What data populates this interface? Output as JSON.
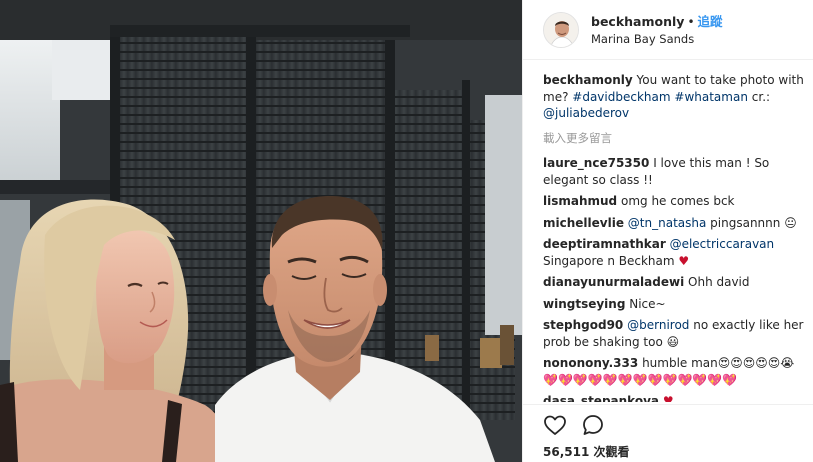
{
  "post": {
    "owner": "beckhamonly",
    "separator": "•",
    "follow_label": "追蹤",
    "location": "Marina Bay Sands"
  },
  "caption": {
    "user": "beckhamonly",
    "text_start": "You want to take photo with me?",
    "hashtag1": "#davidbeckham",
    "hashtag2": "#whataman",
    "credit_prefix": "cr.:",
    "mention": "@juliabederov"
  },
  "load_more_label": "載入更多留言",
  "comments": [
    {
      "user": "laure_nce75350",
      "text": "I love this man ! So elegant so class !!"
    },
    {
      "user": "lismahmud",
      "text": "omg he comes bck"
    },
    {
      "user": "michellevlie",
      "mention": "@tn_natasha",
      "text": "pingsannnn 😐"
    },
    {
      "user": "deeptiramnathkar",
      "mention": "@electriccaravan",
      "text": "Singapore n Beckham",
      "emoji": "♥"
    },
    {
      "user": "dianayunurmaladewi",
      "text": "Ohh david"
    },
    {
      "user": "wingtseying",
      "text": "Nice~"
    },
    {
      "user": "stephgod90",
      "mention": "@bernirod",
      "text": "no exactly like her prob be shaking too 😃"
    },
    {
      "user": "nononony.333",
      "text": "humble man😍😍😍😍😍😭",
      "emoji": "💖💖💖💖💖💖💖💖💖💖💖💖💖"
    },
    {
      "user": "dasa_stepankova",
      "emoji": "♥"
    }
  ],
  "actions": {
    "likes_count": "56,511",
    "likes_suffix": "次觀看",
    "like_icon": "heart-outline-icon",
    "comment_icon": "comment-bubble-icon"
  },
  "colors": {
    "link": "#003569",
    "follow": "#3897f0",
    "text": "#262626",
    "muted": "#999999"
  }
}
